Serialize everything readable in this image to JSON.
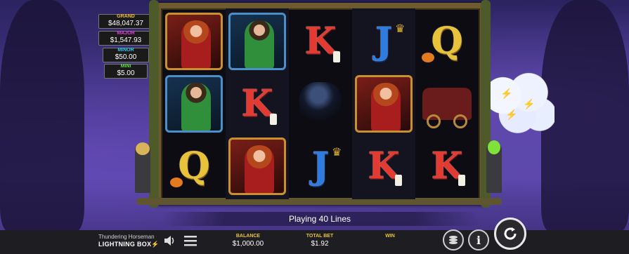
{
  "jackpots": [
    {
      "label": "GRAND",
      "value": "$48,047.37",
      "color": "#f1c232"
    },
    {
      "label": "MAJOR",
      "value": "$1,547.93",
      "color": "#e23be0"
    },
    {
      "label": "MINOR",
      "value": "$50.00",
      "color": "#2fc7e8"
    },
    {
      "label": "MINI",
      "value": "$5.00",
      "color": "#5ae02f"
    }
  ],
  "reels": [
    [
      "woman",
      "man",
      "Q"
    ],
    [
      "man",
      "K",
      "woman"
    ],
    [
      "K",
      "raven",
      "J"
    ],
    [
      "J",
      "woman",
      "K"
    ],
    [
      "Q",
      "carriage",
      "K"
    ]
  ],
  "lines_text": "Playing 40 Lines",
  "footer": {
    "game_name": "Thundering Horseman",
    "brand": "LIGHTNING BOX",
    "balance_label": "BALANCE",
    "balance_value": "$1,000.00",
    "bet_label": "TOTAL BET",
    "bet_value": "$1.92",
    "win_label": "WIN",
    "win_value": ""
  },
  "icons": [
    "sound-icon",
    "menu-icon",
    "chip-stack-icon",
    "info-icon",
    "spin-icon"
  ]
}
